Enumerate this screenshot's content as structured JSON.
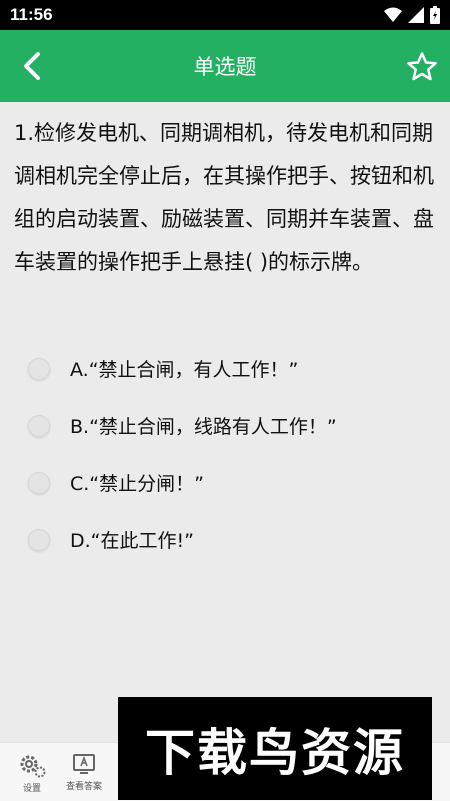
{
  "status_bar": {
    "time": "11:56"
  },
  "header": {
    "title": "单选题",
    "back_icon": "chevron-left-icon",
    "favorite_icon": "star-outline-icon"
  },
  "question": {
    "text": "1.检修发电机、同期调相机，待发电机和同期调相机完全停止后，在其操作把手、按钮和机组的启动装置、励磁装置、同期并车装置、盘车装置的操作把手上悬挂( )的标示牌。"
  },
  "options": [
    {
      "label": "A.“禁止合闸，有人工作！”"
    },
    {
      "label": "B.“禁止合闸，线路有人工作！”"
    },
    {
      "label": "C.“禁止分闸！”"
    },
    {
      "label": "D.“在此工作!”"
    }
  ],
  "bottom_bar": {
    "settings_label": "设置",
    "answer_label": "查看答案"
  },
  "watermark": {
    "text": "下载鸟资源"
  },
  "colors": {
    "accent": "#23b063",
    "status_bar": "#000000",
    "background": "#ebebeb"
  }
}
